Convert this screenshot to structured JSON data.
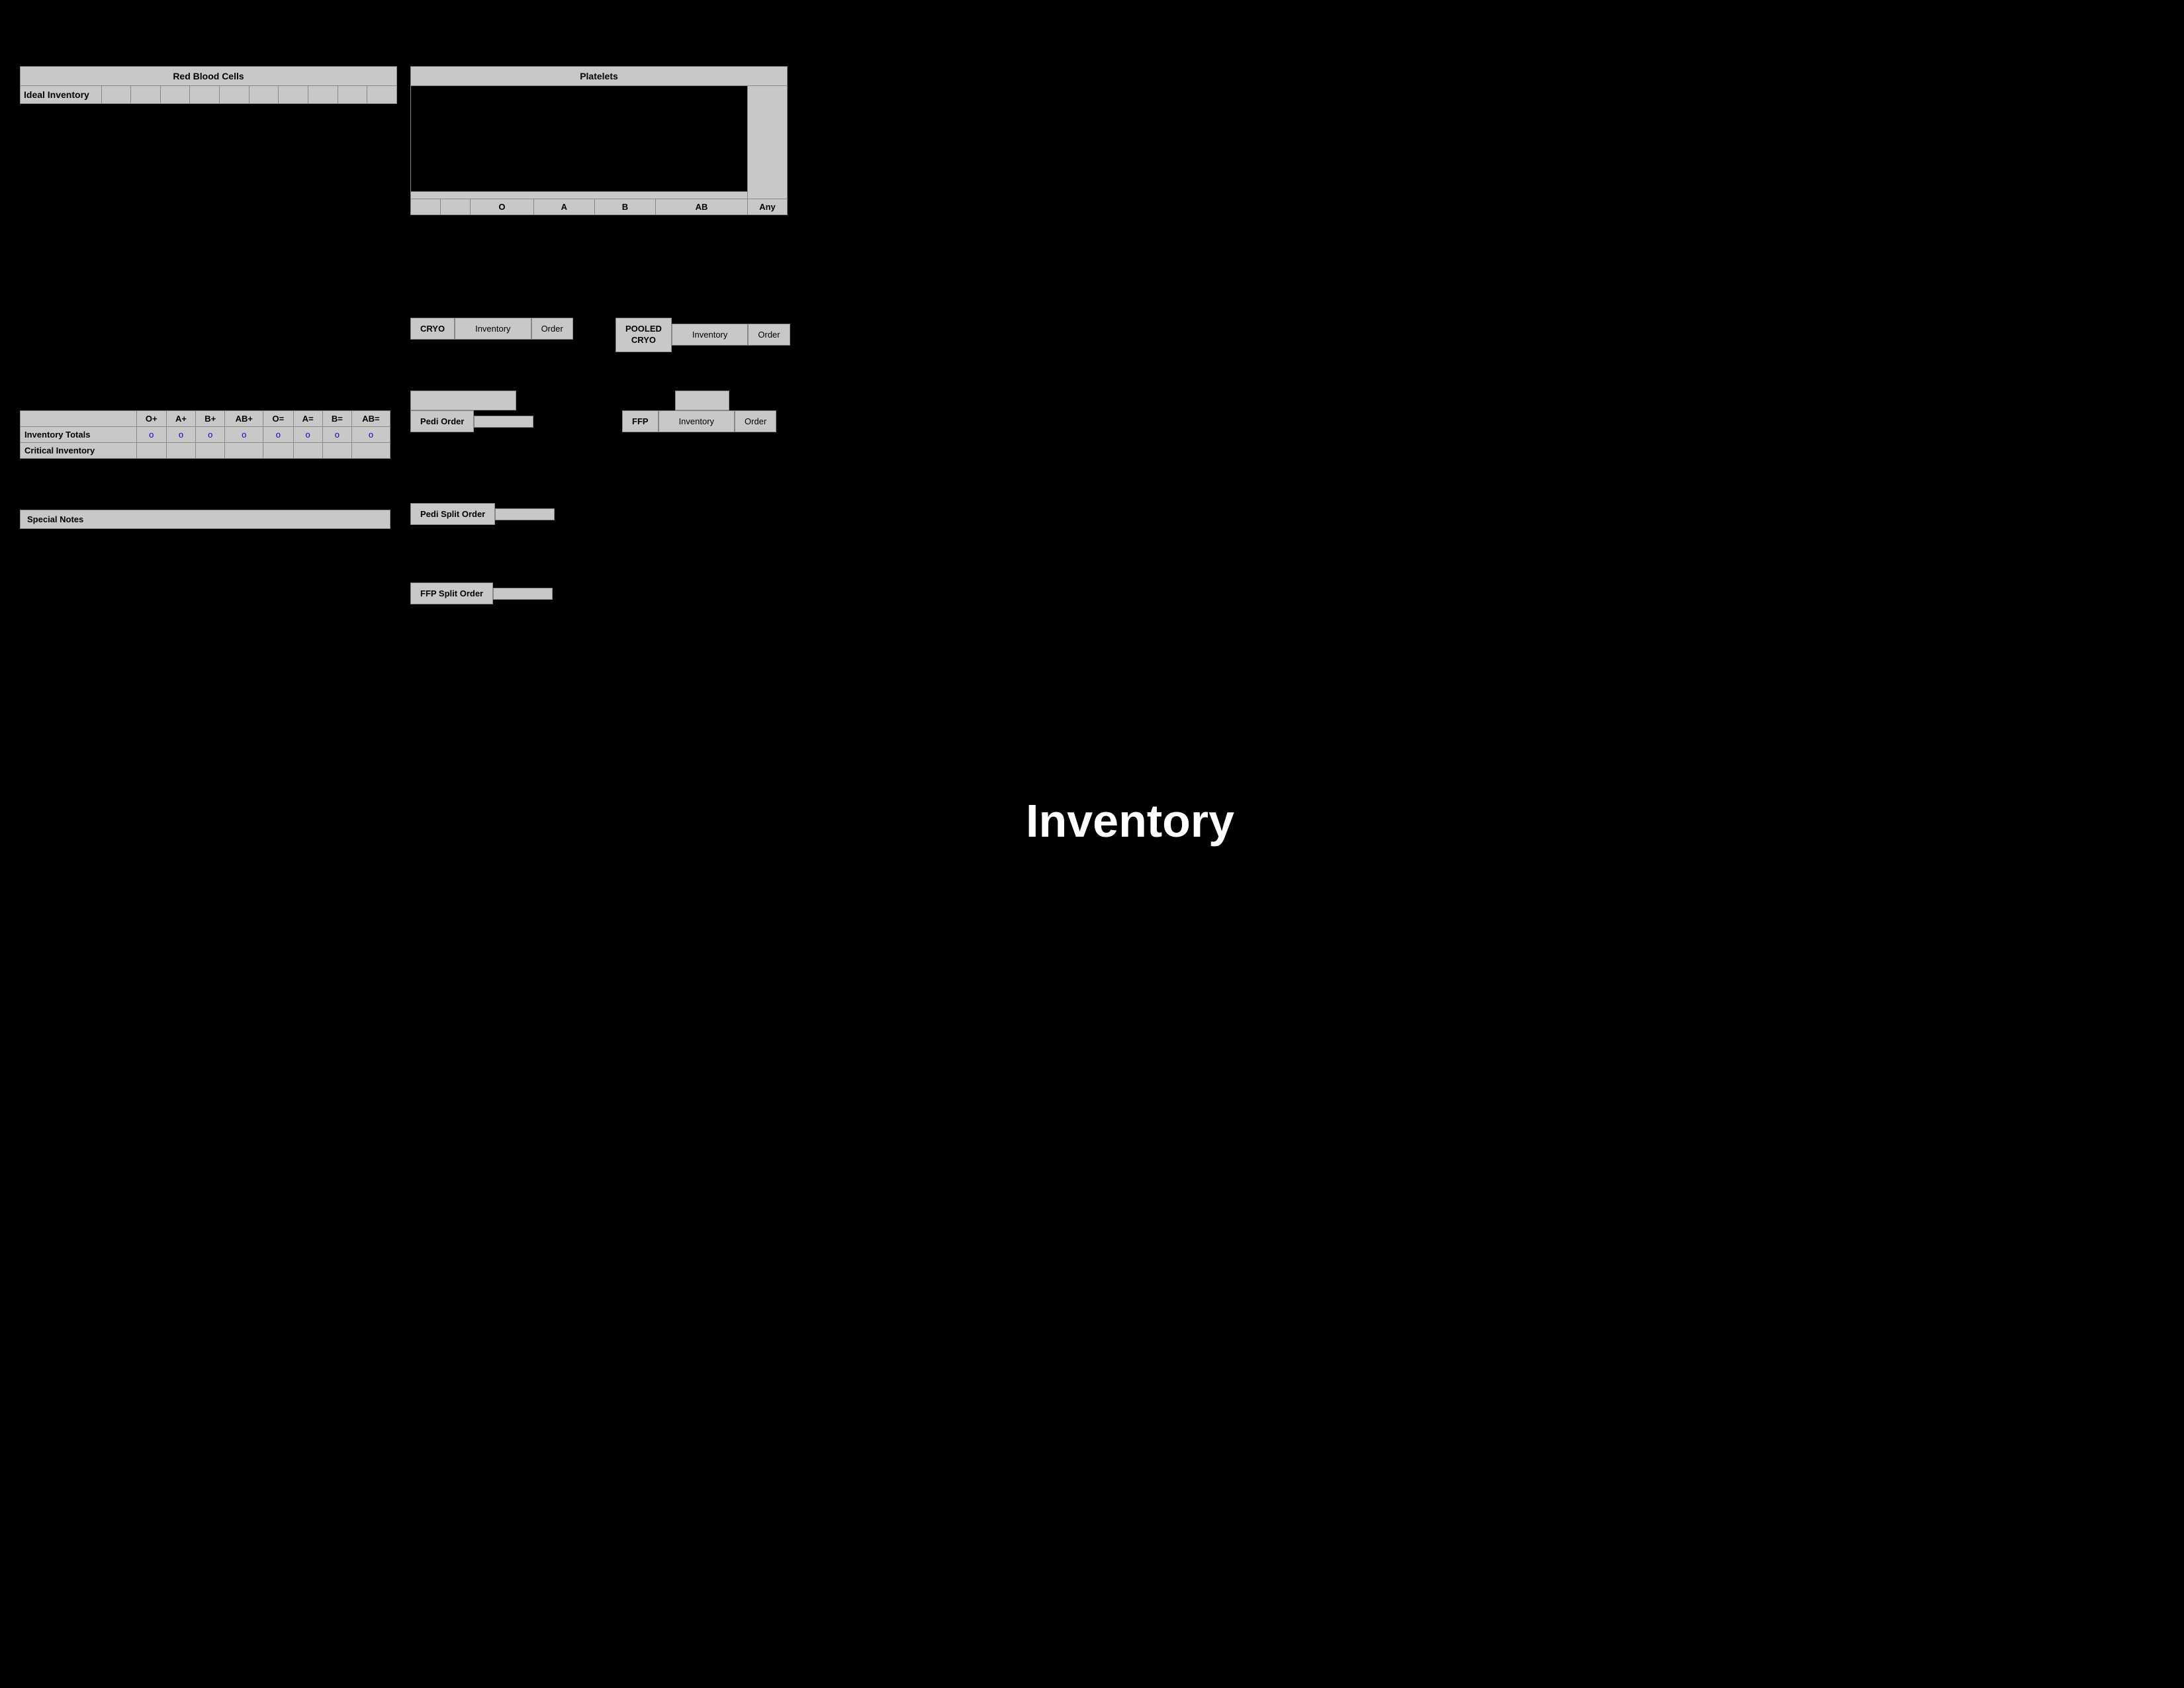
{
  "rbc": {
    "title": "Red Blood Cells",
    "row1_label": "Ideal Inventory",
    "columns": [
      "",
      "",
      "",
      "",
      "",
      "",
      "",
      "",
      "",
      ""
    ],
    "col_values": [
      "",
      "",
      "",
      "",
      "",
      "",
      "",
      "",
      ""
    ]
  },
  "platelets": {
    "title": "Platelets",
    "bottom_labels": [
      "",
      "",
      "O",
      "A",
      "B",
      "AB",
      "Any"
    ]
  },
  "cryo": {
    "label": "CRYO",
    "inventory_label": "Inventory",
    "order_label": "Order"
  },
  "pooled_cryo": {
    "label1": "POOLED",
    "label2": "CRYO",
    "inventory_label": "Inventory",
    "order_label": "Order"
  },
  "inv_totals": {
    "columns": [
      "",
      "O+",
      "A+",
      "B+",
      "AB+",
      "O=",
      "A=",
      "B=",
      "AB="
    ],
    "rows": [
      {
        "label": "Inventory Totals",
        "values": [
          "o",
          "o",
          "o",
          "o",
          "o",
          "o",
          "o",
          "o"
        ],
        "blue": true
      },
      {
        "label": "Critical Inventory",
        "values": [
          "",
          "",
          "",
          "",
          "",
          "",
          "",
          ""
        ],
        "blue": false
      }
    ]
  },
  "special_notes": {
    "label": "Special Notes"
  },
  "pedi_area": {
    "gray_box1": "",
    "gray_box2": "",
    "pedi_order_label": "Pedi Order",
    "pedi_order_value": ""
  },
  "ffp": {
    "label": "FFP",
    "inventory_label": "Inventory",
    "order_label": "Order",
    "gray_box": ""
  },
  "pedi_split": {
    "label": "Pedi Split Order",
    "value": ""
  },
  "ffp_split": {
    "label": "FFP Split Order",
    "value": ""
  },
  "inventory_large": {
    "text": "Inventory"
  }
}
